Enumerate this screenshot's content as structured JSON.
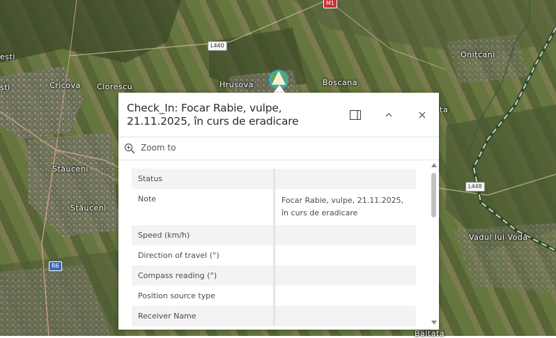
{
  "map": {
    "places": {
      "onitcani": "Onițcani",
      "cricova": "Cricova",
      "ciorescu": "Ciorescu",
      "hrusova": "Hrușova",
      "boscana": "Boșcana",
      "stauceni_1": "Stăuceni",
      "stauceni_2": "Stăuceni",
      "vadul_lui_voda": "Vadul lui Vodă",
      "edge_left_1": "ești",
      "edge_left_2": "ști",
      "edge_right_1": "ța",
      "bottom_right": "Băltata"
    },
    "roads": {
      "l440": "L440",
      "l448": "L448",
      "r6": "R6",
      "m1": "M1"
    },
    "marker_icon": "triangle-marker-icon"
  },
  "popup": {
    "title": "Check_In: Focar Rabie, vulpe, 21.11.2025, în curs de eradicare",
    "dock_icon": "dock-icon",
    "collapse_icon": "chevron-up-icon",
    "close_icon": "close-icon",
    "zoom_label": "Zoom to",
    "attributes": [
      {
        "field": "Status",
        "value": ""
      },
      {
        "field": "Note",
        "value": "Focar Rabie, vulpe, 21.11.2025, în curs de eradicare"
      },
      {
        "field": "Speed (km/h)",
        "value": ""
      },
      {
        "field": "Direction of travel (°)",
        "value": ""
      },
      {
        "field": "Compass reading (°)",
        "value": ""
      },
      {
        "field": "Position source type",
        "value": ""
      },
      {
        "field": "Receiver Name",
        "value": ""
      }
    ]
  }
}
